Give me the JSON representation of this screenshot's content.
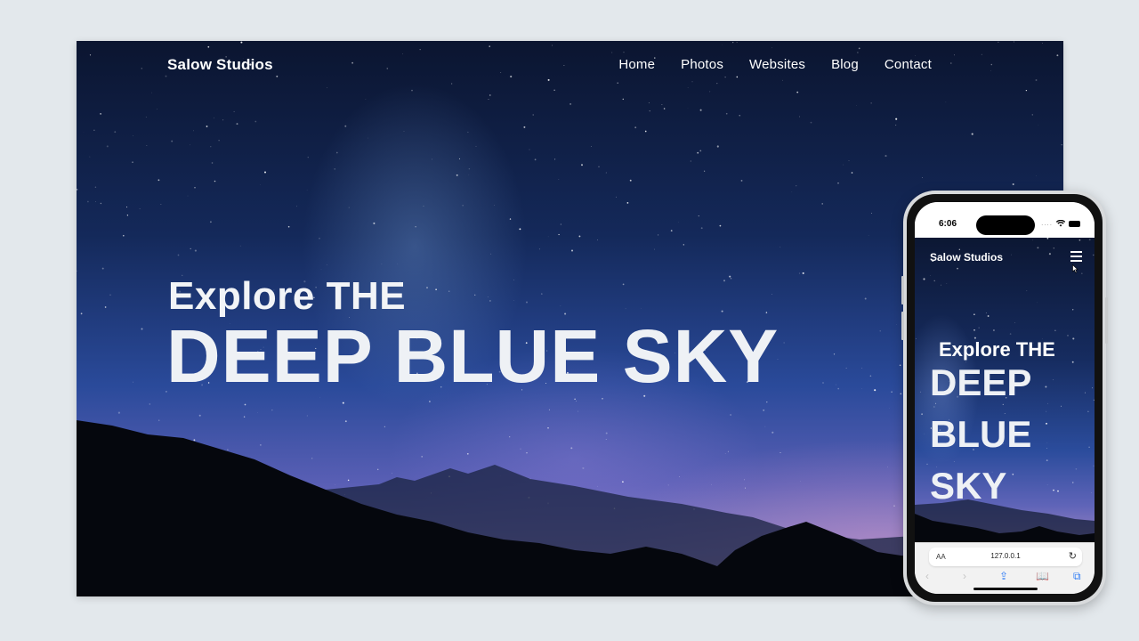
{
  "desktop": {
    "brand": "Salow Studios",
    "nav": [
      "Home",
      "Photos",
      "Websites",
      "Blog",
      "Contact"
    ],
    "hero": {
      "subtitle": "Explore THE",
      "title": "DEEP BLUE SKY"
    }
  },
  "phone": {
    "status": {
      "time": "6:06",
      "dots": "...."
    },
    "brand": "Salow Studios",
    "hero": {
      "subtitle": "Explore THE",
      "title": "DEEP BLUE SKY"
    },
    "browser": {
      "text_size_label": "AA",
      "url": "127.0.0.1",
      "reload": "↻",
      "toolbar": [
        "‹",
        "›",
        "⇪",
        "📖",
        "⧉"
      ]
    }
  },
  "colors": {
    "page_bg": "#e3e8ec",
    "sky_top": "#0b1530",
    "sky_horizon": "#b88fbc",
    "text": "#ffffff",
    "safari_accent": "#2f7cf6"
  }
}
